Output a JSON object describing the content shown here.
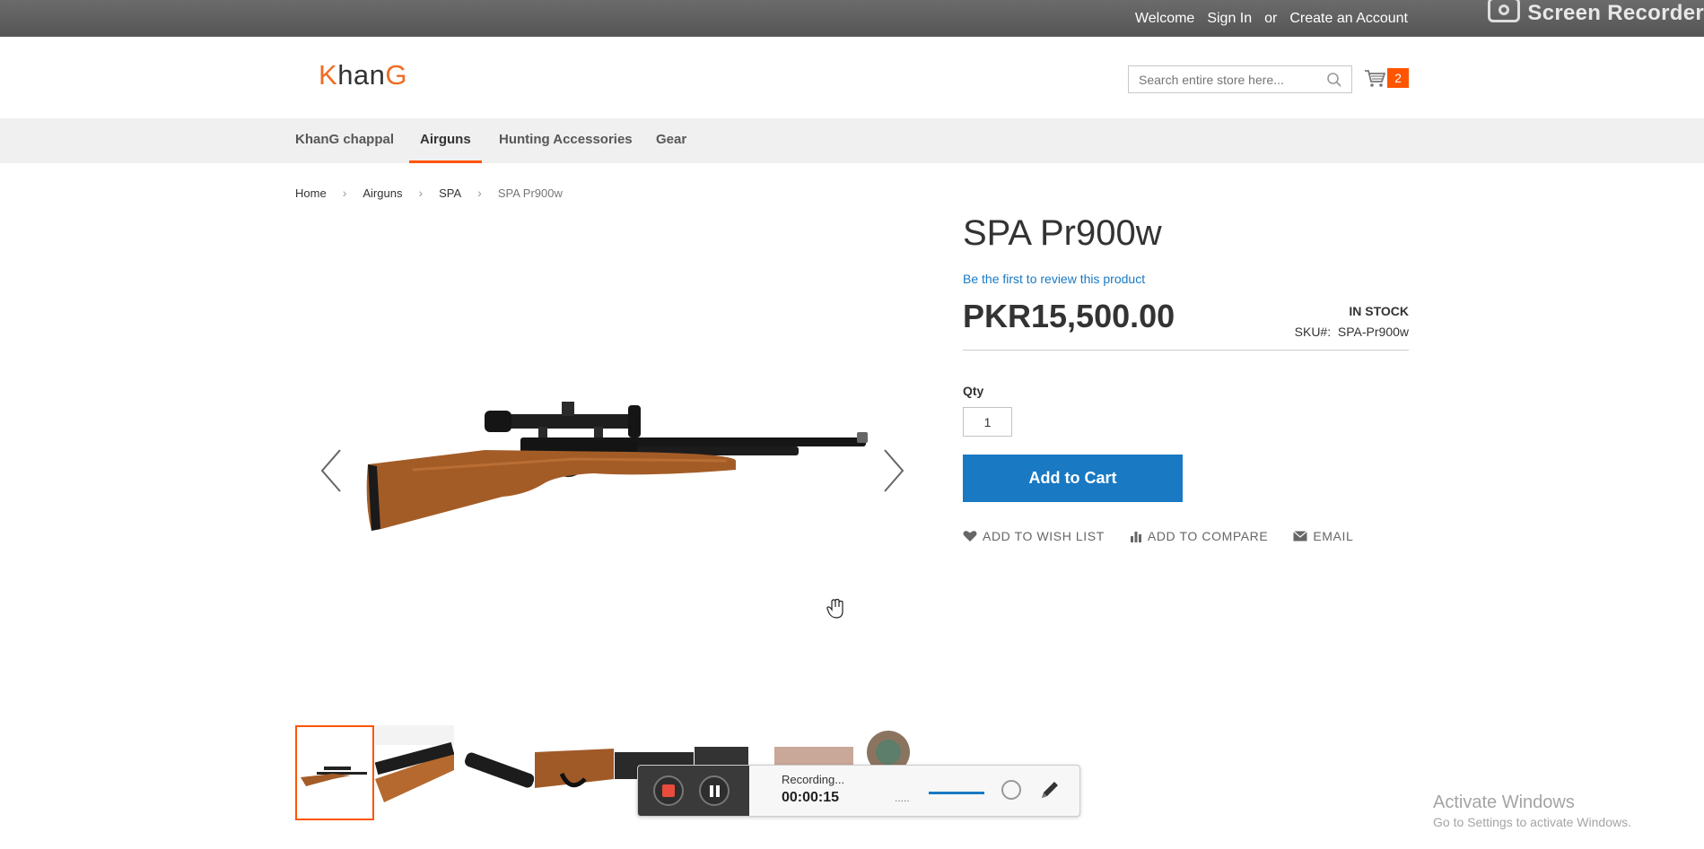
{
  "top_bar": {
    "welcome": "Welcome",
    "sign_in": "Sign In",
    "or": "or",
    "create_account": "Create an Account",
    "recorder_brand": "Screen Recorder"
  },
  "header": {
    "logo_k": "K",
    "logo_han": "han",
    "logo_g": "G",
    "search_placeholder": "Search entire store here...",
    "cart_count": "2"
  },
  "nav": {
    "items": [
      {
        "label": "KhanG chappal"
      },
      {
        "label": "Airguns"
      },
      {
        "label": "Hunting Accessories"
      },
      {
        "label": "Gear"
      }
    ],
    "active": "Airguns"
  },
  "breadcrumb": {
    "items": [
      "Home",
      "Airguns",
      "SPA",
      "SPA Pr900w"
    ]
  },
  "product": {
    "title": "SPA Pr900w",
    "review_link": "Be the first to review this product",
    "price": "PKR15,500.00",
    "stock": "IN STOCK",
    "sku_label": "SKU#:",
    "sku_value": "SPA-Pr900w",
    "qty_label": "Qty",
    "qty_value": "1",
    "add_to_cart": "Add to Cart",
    "actions": {
      "wish": "ADD TO WISH LIST",
      "compare": "ADD TO COMPARE",
      "email": "EMAIL"
    }
  },
  "recorder": {
    "status": "Recording...",
    "time": "00:00:15",
    "level": "....."
  },
  "windows_notice": {
    "title": "Activate Windows",
    "subtitle": "Go to Settings to activate Windows."
  },
  "colors": {
    "accent": "#ff5501",
    "primary_button": "#1979c3",
    "top_bar": "#5e5e5e"
  }
}
